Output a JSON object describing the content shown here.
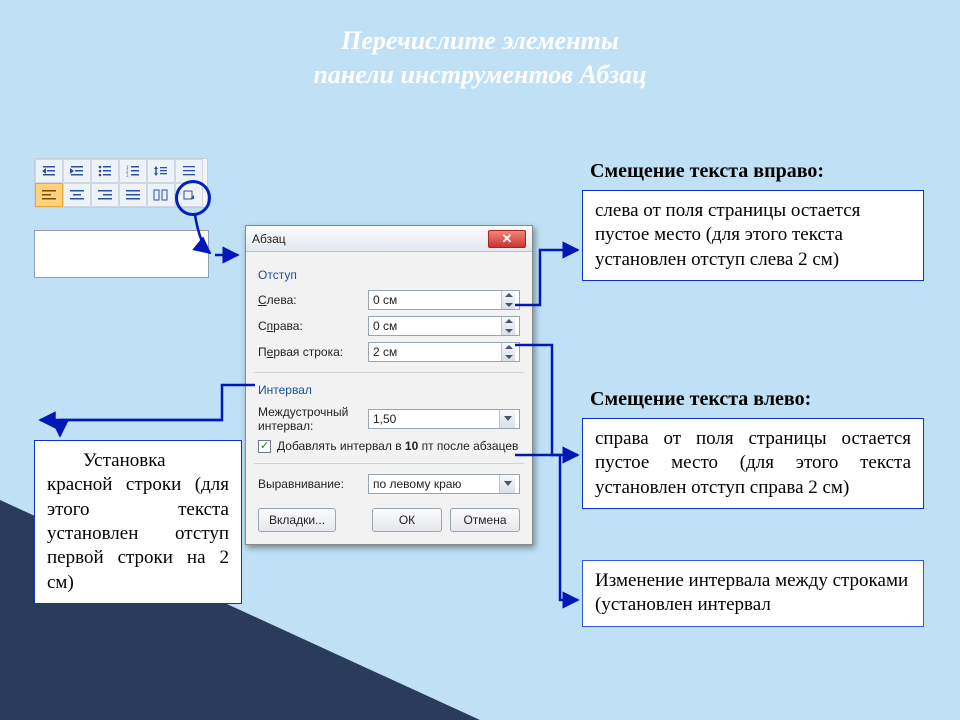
{
  "title_line1": "Перечислите элементы",
  "title_line2": "панели инструментов Абзац",
  "headings": {
    "shift_right": "Смещение текста вправо:",
    "shift_left": "Смещение текста влево:"
  },
  "boxes": {
    "right1": "слева от поля страницы остается пустое место (для этого текста установлен отступ слева 2 см)",
    "right2": "справа от поля страницы остается пустое место (для этого текста установлен отступ справа 2 см)",
    "right3": "Изменение интервала между строками (установлен интервал",
    "left1": "Установка красной строки (для этого текста установлен отступ первой строки на 2 см)"
  },
  "dialog": {
    "title": "Абзац",
    "section_indent": "Отступ",
    "labels": {
      "left": "Слева:",
      "right": "Справа:",
      "first_line": "Первая строка:",
      "line_spacing_a": "Междустрочный",
      "line_spacing_b": "интервал:",
      "alignment": "Выравнивание:"
    },
    "values": {
      "left": "0 см",
      "right": "0 см",
      "first_line": "2 см",
      "line_spacing": "1,50",
      "alignment": "по левому краю"
    },
    "section_interval": "Интервал",
    "checkbox": "Добавлять интервал в 10 пт после абзацев",
    "buttons": {
      "tabs": "Вкладки...",
      "ok": "ОК",
      "cancel": "Отмена"
    }
  }
}
